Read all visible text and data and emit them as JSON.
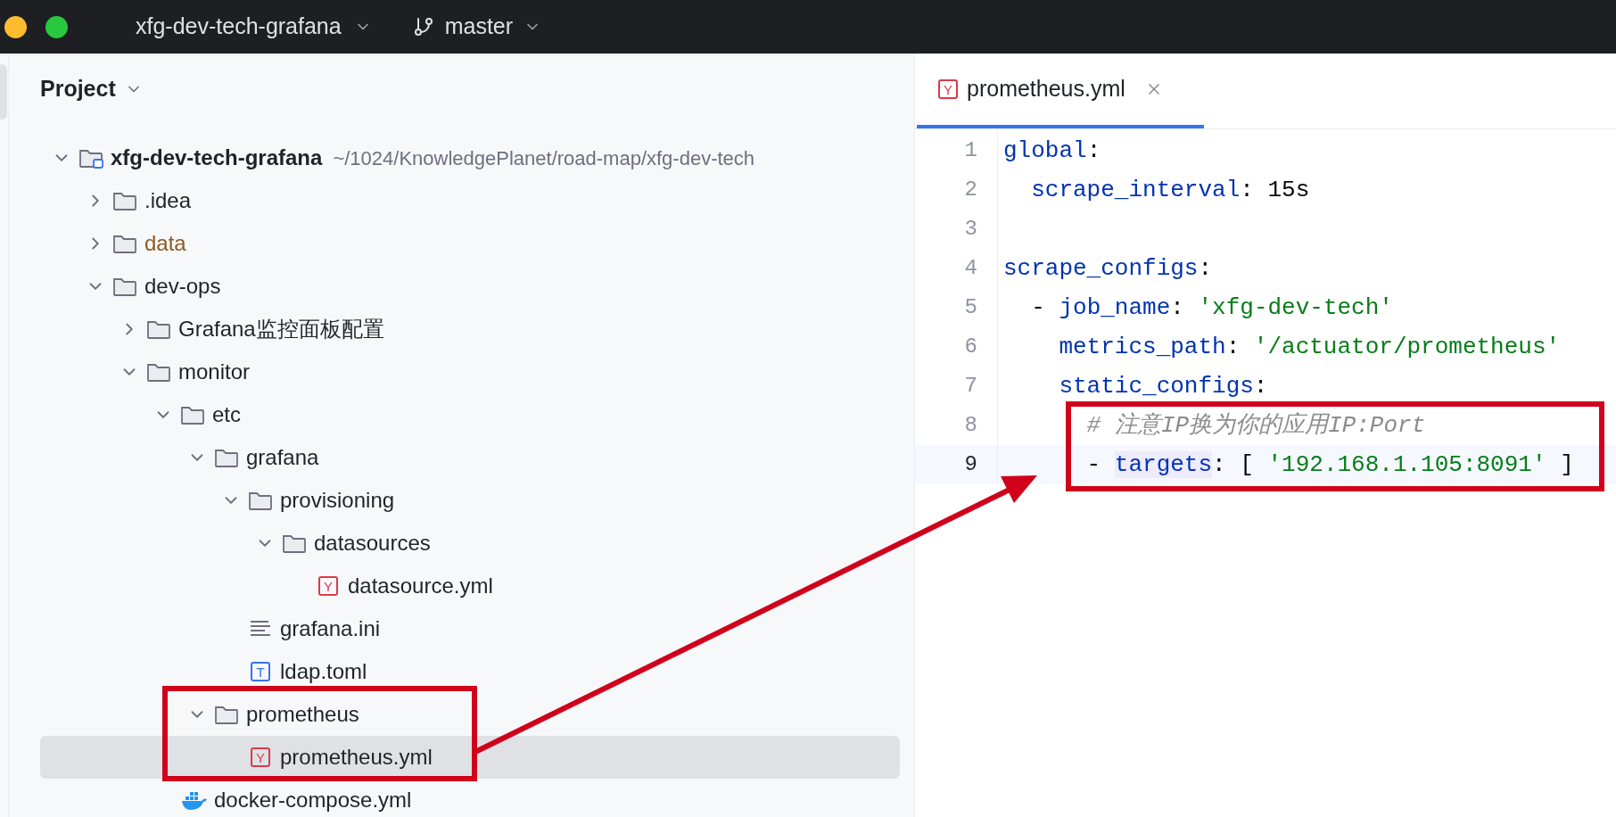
{
  "title_bar": {
    "project": "xfg-dev-tech-grafana",
    "branch": "master"
  },
  "project_panel": {
    "title": "Project",
    "tree": [
      {
        "name": "xfg-dev-tech-grafana",
        "kind": "module",
        "path": "~/1024/KnowledgePlanet/road-map/xfg-dev-tech",
        "expanded": true,
        "selected": false,
        "children": [
          {
            "name": ".idea",
            "kind": "folder",
            "expanded": false,
            "selected": false
          },
          {
            "name": "data",
            "kind": "folder",
            "expanded": false,
            "excluded": true,
            "selected": false
          },
          {
            "name": "dev-ops",
            "kind": "folder",
            "expanded": true,
            "selected": false,
            "children": [
              {
                "name": "Grafana监控面板配置",
                "kind": "folder",
                "expanded": false,
                "selected": false
              },
              {
                "name": "monitor",
                "kind": "folder",
                "expanded": true,
                "selected": false,
                "children": [
                  {
                    "name": "etc",
                    "kind": "folder",
                    "expanded": true,
                    "selected": false,
                    "children": [
                      {
                        "name": "grafana",
                        "kind": "folder",
                        "expanded": true,
                        "selected": false,
                        "children": [
                          {
                            "name": "provisioning",
                            "kind": "folder",
                            "expanded": true,
                            "selected": false,
                            "children": [
                              {
                                "name": "datasources",
                                "kind": "folder",
                                "expanded": true,
                                "selected": false,
                                "children": [
                                  {
                                    "name": "datasource.yml",
                                    "kind": "yaml",
                                    "icon_text": "Y",
                                    "selected": false
                                  }
                                ]
                              }
                            ]
                          },
                          {
                            "name": "grafana.ini",
                            "kind": "text",
                            "selected": false
                          },
                          {
                            "name": "ldap.toml",
                            "kind": "toml",
                            "icon_text": "T",
                            "selected": false
                          }
                        ]
                      },
                      {
                        "name": "prometheus",
                        "kind": "folder",
                        "expanded": true,
                        "selected": false,
                        "children": [
                          {
                            "name": "prometheus.yml",
                            "kind": "yaml",
                            "icon_text": "Y",
                            "selected": true
                          }
                        ]
                      }
                    ]
                  },
                  {
                    "name": "docker-compose.yml",
                    "kind": "docker",
                    "selected": false
                  }
                ]
              }
            ]
          }
        ]
      }
    ]
  },
  "editor": {
    "tabs": [
      {
        "label": "prometheus.yml",
        "icon_text": "Y",
        "selected": true
      }
    ],
    "lines": [
      {
        "number": "1",
        "current": false,
        "tokens": [
          {
            "kind": "key",
            "text": "global"
          },
          {
            "kind": "plain",
            "text": ":"
          }
        ]
      },
      {
        "number": "2",
        "current": false,
        "tokens": [
          {
            "kind": "key",
            "text": "  scrape_interval"
          },
          {
            "kind": "plain",
            "text": ": 15s"
          }
        ]
      },
      {
        "number": "3",
        "current": false
      },
      {
        "number": "4",
        "current": false,
        "tokens": [
          {
            "kind": "key",
            "text": "scrape_configs"
          },
          {
            "kind": "plain",
            "text": ":"
          }
        ]
      },
      {
        "number": "5",
        "current": false,
        "tokens": [
          {
            "kind": "plain",
            "text": "  - "
          },
          {
            "kind": "key",
            "text": "job_name"
          },
          {
            "kind": "plain",
            "text": ": "
          },
          {
            "kind": "string",
            "text": "'xfg-dev-tech'"
          }
        ]
      },
      {
        "number": "6",
        "current": false,
        "tokens": [
          {
            "kind": "key",
            "text": "    metrics_path"
          },
          {
            "kind": "plain",
            "text": ": "
          },
          {
            "kind": "string",
            "text": "'/actuator/prometheus'"
          }
        ]
      },
      {
        "number": "7",
        "current": false,
        "tokens": [
          {
            "kind": "key",
            "text": "    static_configs"
          },
          {
            "kind": "plain",
            "text": ":"
          }
        ]
      },
      {
        "number": "8",
        "current": false,
        "tokens": [
          {
            "kind": "comment",
            "text": "      # 注意IP换为你的应用IP:Port"
          }
        ]
      },
      {
        "number": "9",
        "current": true,
        "tokens": [
          {
            "kind": "plain",
            "text": "      - "
          },
          {
            "kind": "key",
            "text": "targets",
            "highlighted": true
          },
          {
            "kind": "plain",
            "text": ": [ "
          },
          {
            "kind": "string",
            "text": "'192.168.1.105:8091'"
          },
          {
            "kind": "plain",
            "text": " ]"
          }
        ]
      }
    ]
  }
}
